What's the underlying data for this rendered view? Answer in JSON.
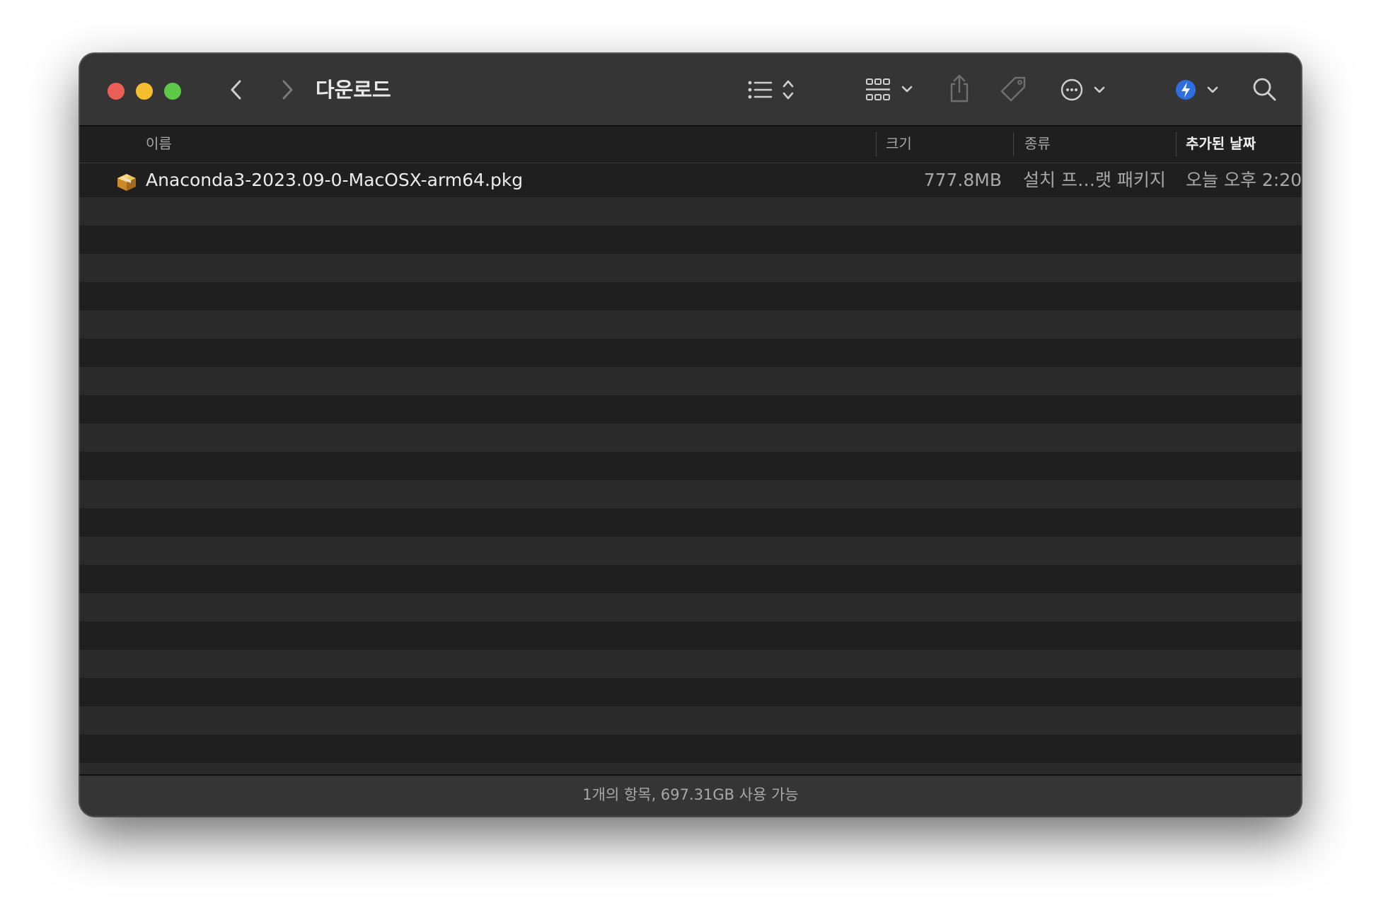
{
  "window": {
    "title": "다운로드"
  },
  "toolbar": {
    "back_icon": "chevron-left-icon",
    "forward_icon": "chevron-right-icon",
    "view_list_icon": "list-view-icon",
    "group_icon": "grid-group-icon",
    "share_icon": "share-icon",
    "tag_icon": "tag-icon",
    "more_icon": "ellipsis-circle-icon",
    "app_icon": "xcode-instruments-icon",
    "search_icon": "search-icon"
  },
  "columns": {
    "name": "이름",
    "size": "크기",
    "kind": "종류",
    "date_added": "추가된 날짜"
  },
  "files": [
    {
      "icon": "package-icon",
      "name": "Anaconda3-2023.09-0-MacOSX-arm64.pkg",
      "size": "777.8MB",
      "kind": "설치 프…랫 패키지",
      "date_added": "오늘 오후 2:20"
    }
  ],
  "status": {
    "text": "1개의 항목, 697.31GB 사용 가능"
  },
  "colors": {
    "close": "#ec5f57",
    "minimize": "#f5bd30",
    "maximize": "#5ec847",
    "accent": "#2f6ee0"
  }
}
